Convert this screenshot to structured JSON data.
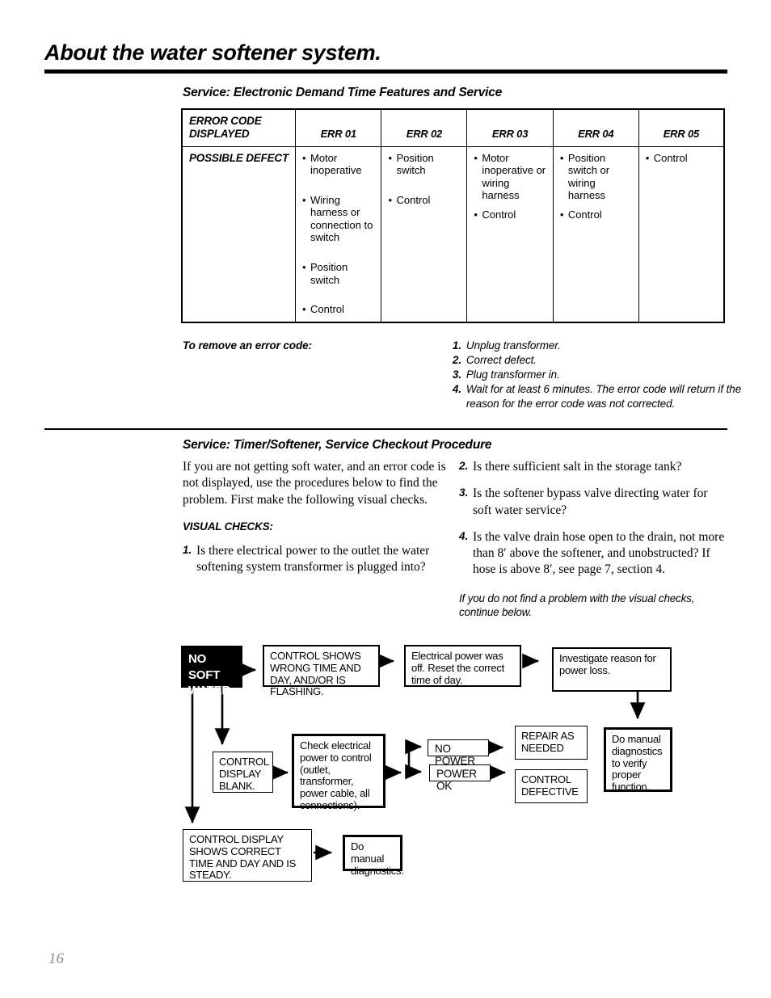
{
  "page": {
    "title": "About the water softener system.",
    "number": "16"
  },
  "section1": {
    "heading": "Service: Electronic Demand Time Features and Service",
    "table": {
      "row_header_label": "ERROR CODE\nDISPLAYED",
      "row_header_line1": "ERROR CODE",
      "row_header_line2": "DISPLAYED",
      "columns": [
        "ERR 01",
        "ERR 02",
        "ERR 03",
        "ERR 04",
        "ERR 05"
      ],
      "defect_row_label": "POSSIBLE DEFECT",
      "defects": [
        [
          "Motor inoperative",
          "Wiring harness or connection to switch",
          "Position switch",
          "Control"
        ],
        [
          "Position switch",
          "Control"
        ],
        [
          "Motor inoperative or wiring harness",
          "Control"
        ],
        [
          "Position switch or wiring harness",
          "Control"
        ],
        [
          "Control"
        ]
      ]
    },
    "remove_label": "To remove an error code:",
    "remove_steps": [
      {
        "num": "1.",
        "text": "Unplug transformer."
      },
      {
        "num": "2.",
        "text": "Correct defect."
      },
      {
        "num": "3.",
        "text": "Plug transformer in."
      },
      {
        "num": "4.",
        "text": "Wait for at least 6 minutes. The error code will return if the reason for the error code was not corrected."
      }
    ]
  },
  "section2": {
    "heading": "Service: Timer/Softener, Service Checkout Procedure",
    "intro": "If you are not getting soft water, and an error code is not displayed, use the procedures below to find the problem. First make the following visual checks.",
    "visual_checks_heading": "VISUAL CHECKS:",
    "checks": [
      {
        "num": "1.",
        "text": "Is there electrical power to the outlet the water softening system transformer is plugged into?"
      },
      {
        "num": "2.",
        "text": "Is there sufficient salt in the storage tank?"
      },
      {
        "num": "3.",
        "text": "Is the softener bypass valve directing water for soft water service?"
      },
      {
        "num": "4.",
        "text": "Is the valve drain hose open to the drain, not more than 8′ above the softener, and unobstructed? If hose is above 8′, see page 7, section 4."
      }
    ],
    "closing_note": "If you do not find a problem with the visual checks, continue below."
  },
  "flowchart": {
    "start": {
      "line1": "NO SOFT",
      "line2": "WATER"
    },
    "nodes": {
      "wrong_time": "CONTROL SHOWS WRONG TIME AND DAY, AND/OR IS FLASHING.",
      "power_off": "Electrical power was off. Reset the correct time of day.",
      "investigate": "Investigate reason for power loss.",
      "display_blank": "CONTROL DISPLAY BLANK.",
      "check_power": "Check electrical power to control (outlet, transformer, power cable, all connections).",
      "no_power": "NO POWER",
      "power_ok": "POWER OK",
      "repair": "REPAIR AS NEEDED",
      "control_defective": "CONTROL DEFECTIVE",
      "manual_verify": "Do manual diagnostics to verify proper function.",
      "display_correct": "CONTROL DISPLAY SHOWS CORRECT TIME AND DAY AND IS STEADY.",
      "manual_diag": "Do manual diagnostics."
    }
  }
}
